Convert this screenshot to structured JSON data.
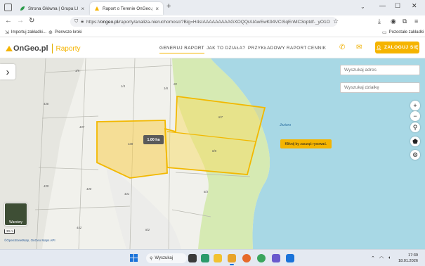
{
  "browser": {
    "tabs": [
      {
        "title": "Strona Główna | Grupa LUX ME"
      },
      {
        "title": "Raport o Terenie OnGeo.pl – A"
      }
    ],
    "url_prefix": "https://",
    "url_domain": "ongeo.pl",
    "url_rest": "/raporty/analiza-nieruchomosci?Big=H4sIAAAAAAAAAGXOQQrAIAwEwK94VCiSqEnMC3optdf-_yO1O",
    "bookmarks": [
      {
        "label": "Importuj zakładki..."
      },
      {
        "label": "Pierwsze kroki"
      }
    ],
    "other_bookmarks": "Pozostałe zakładki"
  },
  "site": {
    "logo_main": "OnGeo.pl",
    "logo_sub": "Raporty",
    "menu": [
      {
        "label": "GENERUJ RAPORT"
      },
      {
        "label": "JAK TO DZIAŁA?"
      },
      {
        "label": "PRZYKŁADOWY RAPORT"
      },
      {
        "label": "CENNIK"
      }
    ],
    "login": "ZALOGUJ SIĘ"
  },
  "map": {
    "search_address_placeholder": "Wyszukaj adres",
    "search_parcel_placeholder": "Wyszukaj działkę",
    "area_badge": "1.00 ha",
    "hint": "Kliknij by zacząć rysować.",
    "layers_label": "Warstwy",
    "scale": "30 m",
    "attribution": "©OpenStreetMap, OnGeo Maps API",
    "lake_label": "Jezioro",
    "parcels": [
      {
        "label": "1/5"
      },
      {
        "label": "1/4"
      },
      {
        "label": "1/6"
      },
      {
        "label": "436"
      },
      {
        "label": "437"
      },
      {
        "label": "438"
      },
      {
        "label": "439"
      },
      {
        "label": "440"
      },
      {
        "label": "441"
      },
      {
        "label": "442"
      },
      {
        "label": "8/7"
      },
      {
        "label": "8/8"
      },
      {
        "label": "8/3"
      },
      {
        "label": "8/2"
      },
      {
        "label": "20"
      }
    ]
  },
  "taskbar": {
    "search": "Wyszukaj",
    "time": "17:39",
    "date": "18.01.2026"
  }
}
